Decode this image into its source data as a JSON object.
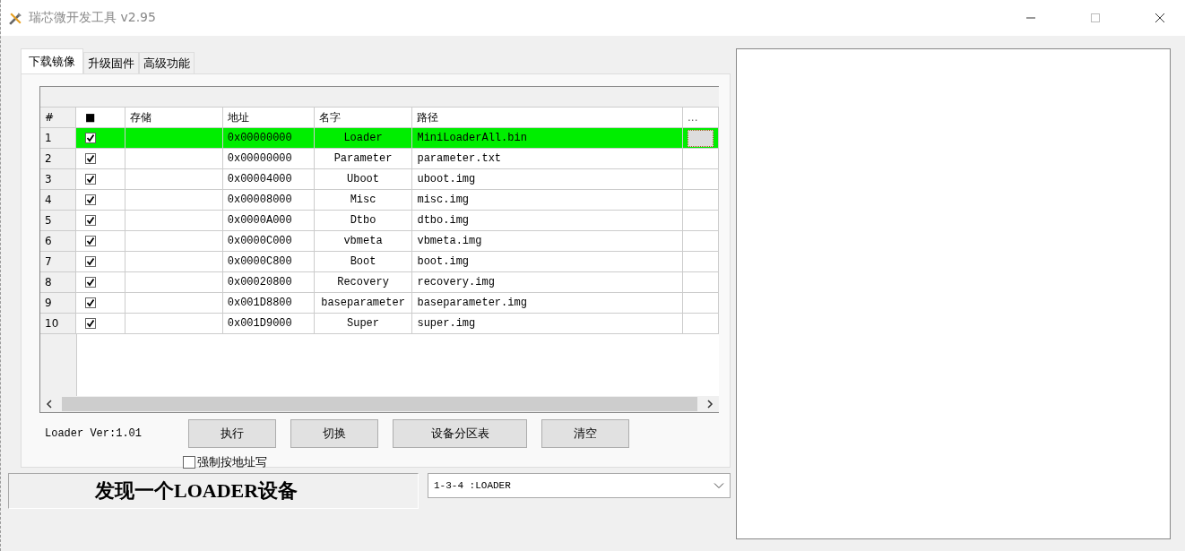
{
  "window": {
    "title": "瑞芯微开发工具 v2.95"
  },
  "tabs": [
    {
      "label": "下载镜像",
      "selected": true
    },
    {
      "label": "升级固件",
      "selected": false
    },
    {
      "label": "高级功能",
      "selected": false
    }
  ],
  "table": {
    "columns": [
      "#",
      "■",
      "存储",
      "地址",
      "名字",
      "路径",
      "..."
    ],
    "rows": [
      {
        "index": "1",
        "checked": true,
        "storage": "",
        "address": "0x00000000",
        "name": "Loader",
        "path": "MiniLoaderAll.bin",
        "selected": true
      },
      {
        "index": "2",
        "checked": true,
        "storage": "",
        "address": "0x00000000",
        "name": "Parameter",
        "path": "parameter.txt",
        "selected": false
      },
      {
        "index": "3",
        "checked": true,
        "storage": "",
        "address": "0x00004000",
        "name": "Uboot",
        "path": "uboot.img",
        "selected": false
      },
      {
        "index": "4",
        "checked": true,
        "storage": "",
        "address": "0x00008000",
        "name": "Misc",
        "path": "misc.img",
        "selected": false
      },
      {
        "index": "5",
        "checked": true,
        "storage": "",
        "address": "0x0000A000",
        "name": "Dtbo",
        "path": "dtbo.img",
        "selected": false
      },
      {
        "index": "6",
        "checked": true,
        "storage": "",
        "address": "0x0000C000",
        "name": "vbmeta",
        "path": "vbmeta.img",
        "selected": false
      },
      {
        "index": "7",
        "checked": true,
        "storage": "",
        "address": "0x0000C800",
        "name": "Boot",
        "path": "boot.img",
        "selected": false
      },
      {
        "index": "8",
        "checked": true,
        "storage": "",
        "address": "0x00020800",
        "name": "Recovery",
        "path": "recovery.img",
        "selected": false
      },
      {
        "index": "9",
        "checked": true,
        "storage": "",
        "address": "0x001D8800",
        "name": "baseparameter",
        "path": "baseparameter.img",
        "selected": false
      },
      {
        "index": "10",
        "checked": true,
        "storage": "",
        "address": "0x001D9000",
        "name": "Super",
        "path": "super.img",
        "selected": false
      }
    ]
  },
  "loader_version": "Loader Ver:1.01",
  "buttons": [
    "执行",
    "切换",
    "设备分区表",
    "清空"
  ],
  "force_address_write": {
    "label": "强制按地址写",
    "checked": false
  },
  "status": "发现一个LOADER设备",
  "device_select": {
    "value": "1-3-4 :LOADER"
  }
}
